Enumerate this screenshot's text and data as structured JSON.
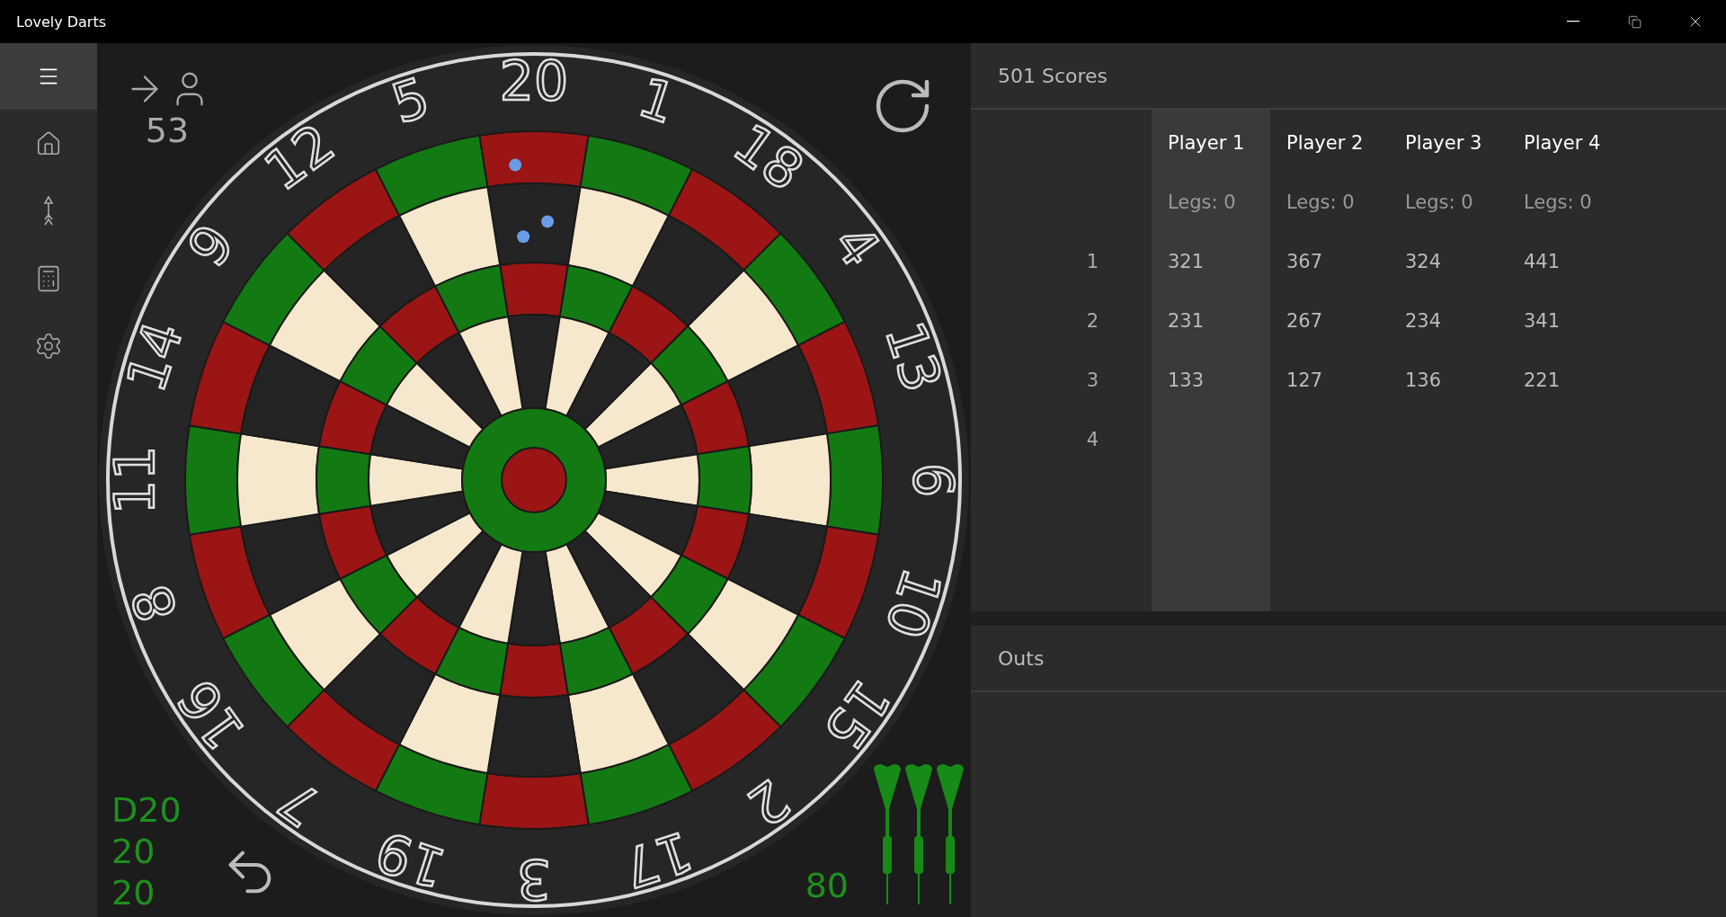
{
  "window": {
    "title": "Lovely Darts"
  },
  "sidebar": {
    "items": [
      {
        "kind": "menu"
      },
      {
        "kind": "home"
      },
      {
        "kind": "dart"
      },
      {
        "kind": "calculator"
      },
      {
        "kind": "settings"
      }
    ]
  },
  "board": {
    "numbers": [
      "20",
      "1",
      "18",
      "4",
      "13",
      "6",
      "10",
      "15",
      "2",
      "17",
      "3",
      "19",
      "7",
      "16",
      "8",
      "11",
      "14",
      "9",
      "12",
      "5"
    ]
  },
  "turn": {
    "remaining": "53"
  },
  "throws": [
    "D20",
    "20",
    "20"
  ],
  "total": "80",
  "darts": [
    {
      "thrown": false
    },
    {
      "thrown": false
    },
    {
      "thrown": false
    }
  ],
  "scores": {
    "title": "501 Scores",
    "rounds": [
      "1",
      "2",
      "3",
      "4"
    ],
    "players": [
      {
        "name": "Player 1",
        "legs": "Legs: 0",
        "selected": true,
        "scores": [
          "321",
          "231",
          "133"
        ]
      },
      {
        "name": "Player 2",
        "legs": "Legs: 0",
        "selected": false,
        "scores": [
          "367",
          "267",
          "127"
        ]
      },
      {
        "name": "Player 3",
        "legs": "Legs: 0",
        "selected": false,
        "scores": [
          "324",
          "234",
          "136"
        ]
      },
      {
        "name": "Player 4",
        "legs": "Legs: 0",
        "selected": false,
        "scores": [
          "441",
          "341",
          "221"
        ]
      }
    ]
  },
  "outs": {
    "title": "Outs"
  }
}
